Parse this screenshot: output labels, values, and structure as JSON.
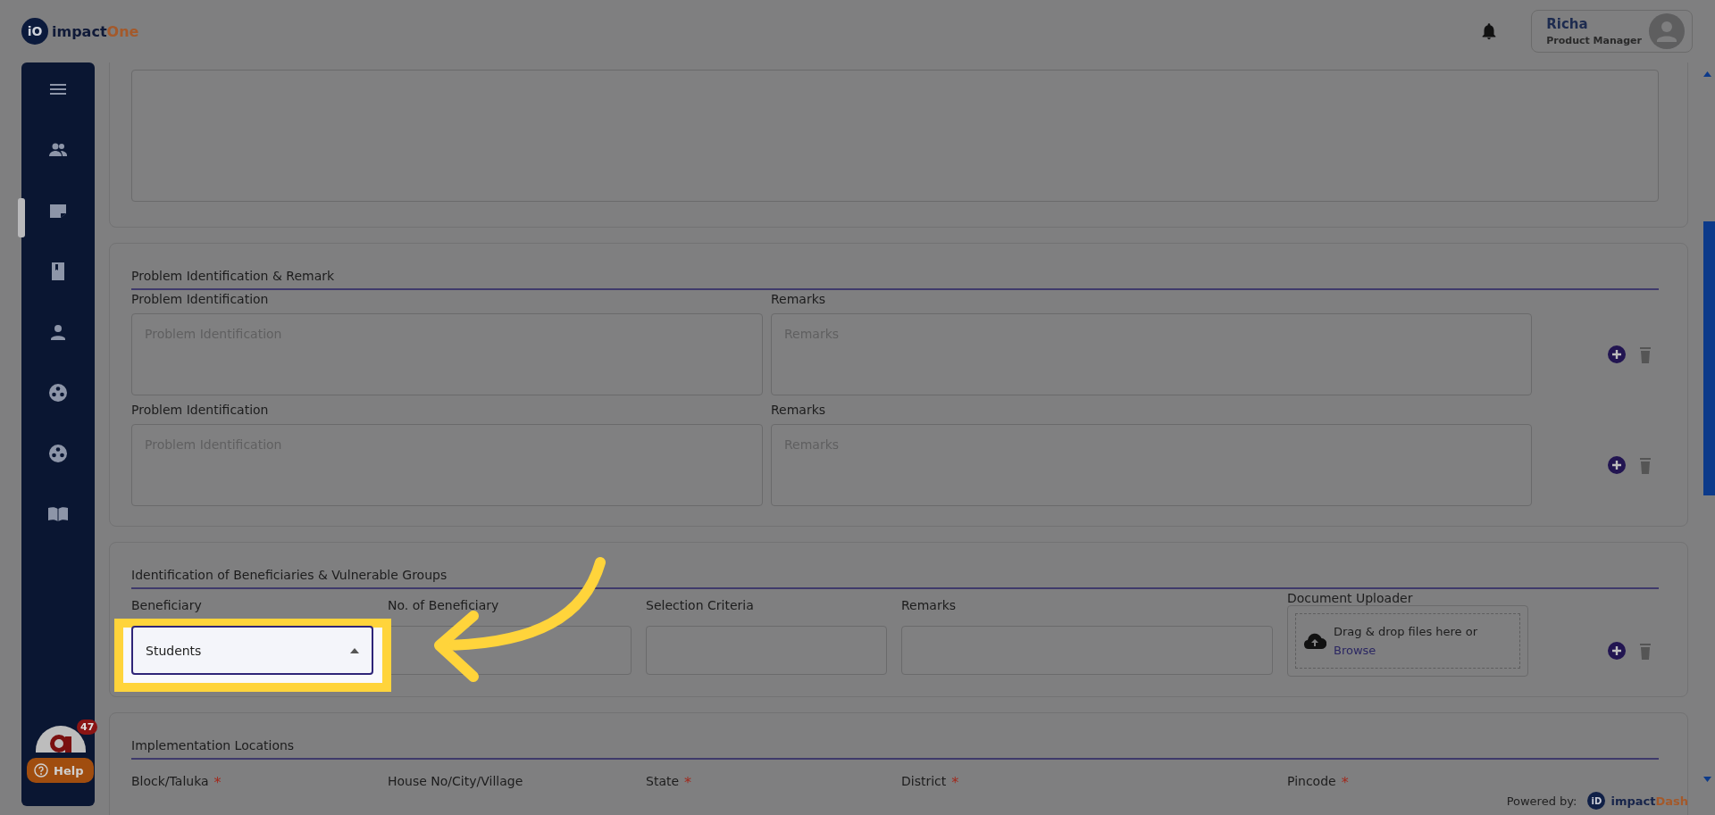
{
  "header": {
    "logo": {
      "mark": "iO",
      "word": "impact",
      "accent": "One"
    },
    "user": {
      "name": "Richa",
      "role": "Product Manager"
    }
  },
  "sidebar": {
    "items": [
      {
        "kind": "menu",
        "selected": false
      },
      {
        "kind": "people",
        "selected": false
      },
      {
        "kind": "note",
        "selected": true
      },
      {
        "kind": "book",
        "selected": false
      },
      {
        "kind": "person",
        "selected": false
      },
      {
        "kind": "reel",
        "selected": false
      },
      {
        "kind": "reel",
        "selected": false
      },
      {
        "kind": "open-book",
        "selected": false
      }
    ]
  },
  "chat": {
    "badge": "47",
    "help": "Help"
  },
  "sections": [
    {
      "kind": "textarea"
    },
    {
      "kind": "rows",
      "title": "Problem Identification & Remark",
      "rows": [
        {
          "fields": [
            {
              "label": "Problem Identification",
              "placeholder": "Problem Identification"
            },
            {
              "label": "Remarks",
              "placeholder": "Remarks"
            }
          ]
        },
        {
          "fields": [
            {
              "label": "Problem Identification",
              "placeholder": "Problem Identification"
            },
            {
              "label": "Remarks",
              "placeholder": "Remarks"
            }
          ]
        }
      ]
    },
    {
      "kind": "beneficiaries",
      "title": "Identification of Beneficiaries & Vulnerable Groups",
      "fields": [
        {
          "kind": "select",
          "label": "Beneficiary",
          "value": "Students",
          "highlighted": true
        },
        {
          "kind": "text",
          "label": "No. of Beneficiary",
          "highlighted": false
        },
        {
          "kind": "text",
          "label": "Selection Criteria",
          "highlighted": false
        },
        {
          "kind": "text",
          "label": "Remarks",
          "highlighted": false
        },
        {
          "kind": "upload",
          "label": "Document Uploader",
          "text": "Drag & drop files here or",
          "link": "Browse",
          "highlighted": false
        }
      ]
    },
    {
      "kind": "locations",
      "title": "Implementation Locations",
      "fields": [
        {
          "label": "Block/Taluka",
          "required_mark": "*"
        },
        {
          "label": "House No/City/Village"
        },
        {
          "label": "State",
          "required_mark": "*"
        },
        {
          "label": "District",
          "required_mark": "*"
        },
        {
          "label": "Pincode",
          "required_mark": "*"
        }
      ]
    }
  ],
  "footer": {
    "powered": "Powered by:",
    "mark": "iD",
    "word": "impact",
    "accent": "Dash"
  }
}
